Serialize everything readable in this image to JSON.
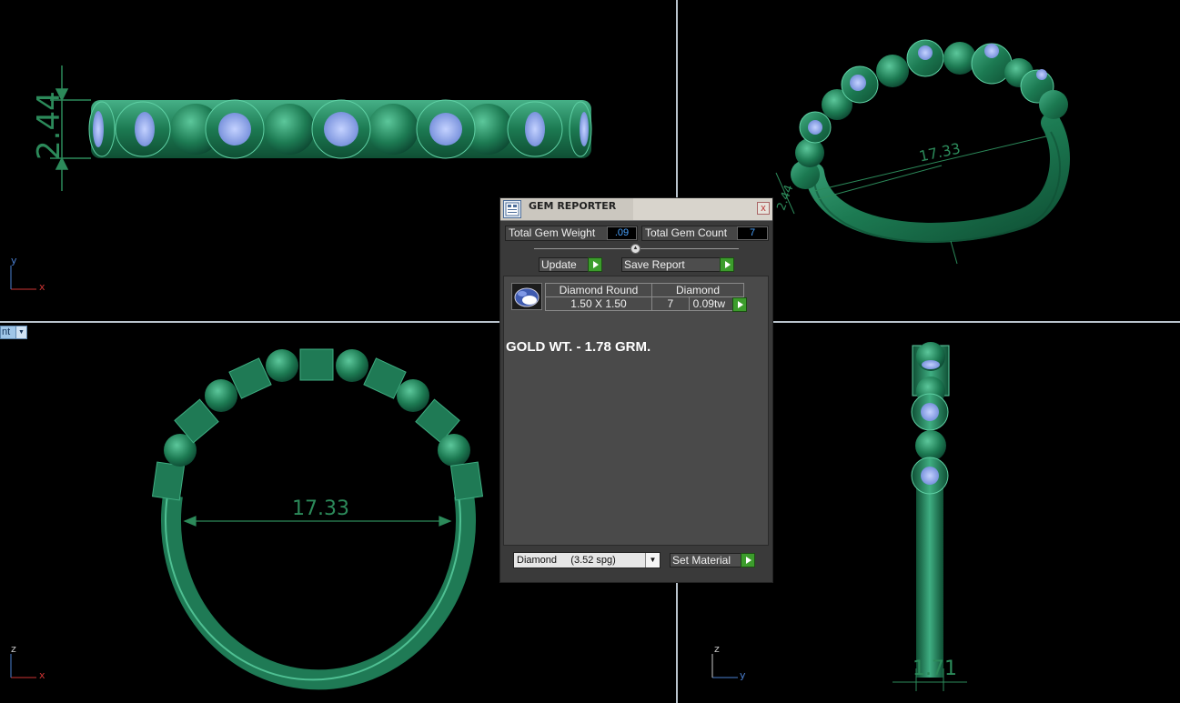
{
  "viewports": {
    "top_left": {
      "dimension": "2.44",
      "axes": [
        "y",
        "x"
      ]
    },
    "top_right": {
      "dimension_main": "17.33",
      "dimension_side": "2.44"
    },
    "bottom_left": {
      "dimension": "17.33",
      "axes": [
        "z",
        "x"
      ],
      "view_tab": "nt"
    },
    "bottom_right": {
      "dimension": "1.71",
      "axes": [
        "z",
        "y"
      ]
    }
  },
  "dialog": {
    "title": "GEM REPORTER",
    "close_label": "x",
    "total_weight_label": "Total Gem Weight",
    "total_weight_value": ".09",
    "total_count_label": "Total Gem Count",
    "total_count_value": "7",
    "update_label": "Update",
    "save_report_label": "Save Report",
    "gem_table": {
      "header": [
        "Diamond Round",
        "Diamond"
      ],
      "row": {
        "size": "1.50 X 1.50",
        "count": "7",
        "weight": "0.09tw"
      }
    },
    "note": "GOLD WT. - 1.78 GRM.",
    "material_select": "Diamond     (3.52 spg)",
    "set_material_label": "Set Material"
  },
  "colors": {
    "metal": "#1f7a55",
    "metal_light": "#3fae82",
    "gem": "#8fa8f0",
    "dim_line": "#2c8a5a",
    "dialog_bg": "#3a3a3a",
    "green_button": "#3c9c2c"
  }
}
